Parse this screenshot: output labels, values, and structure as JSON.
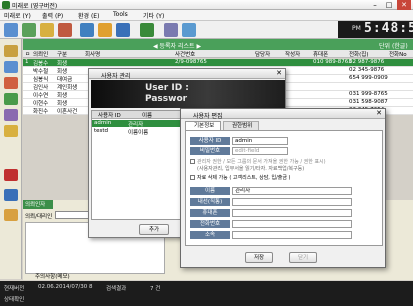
{
  "window": {
    "title": "미래로 (영구버전)"
  },
  "menu": [
    "미래로 (Y)",
    "출력 (P)",
    "환경 (E)",
    "Tools",
    "기타 (Y)"
  ],
  "clock": {
    "ampm": "PM",
    "time": "5:48:5"
  },
  "main": {
    "header_title": "◀ 등록자 리스트 ▶",
    "header_right": "단위 (한글)",
    "columns": [
      "ㅁ",
      "의뢰인",
      "구분",
      "회사명",
      "사건번호",
      "담당자",
      "작성자",
      "휴대폰",
      "전화(집)",
      "전화No"
    ],
    "rows": [
      [
        "1",
        "김봉수",
        "회생",
        "",
        "2/9-098765",
        "",
        "",
        "010 989-8763",
        "02 987-9876",
        ""
      ],
      [
        "",
        "박수철",
        "회생",
        "",
        "",
        "",
        "",
        "",
        "02 345-9876",
        ""
      ],
      [
        "",
        "심봉식",
        "대여금",
        "",
        "",
        "",
        "",
        "",
        "654 999-0909",
        ""
      ],
      [
        "",
        "김인사",
        "계인회생",
        "",
        "",
        "",
        "",
        "",
        "",
        ""
      ],
      [
        "",
        "이수연",
        "회생",
        "",
        "",
        "",
        "",
        "",
        "031 999-8765",
        ""
      ],
      [
        "",
        "이현수",
        "회생",
        "",
        "",
        "",
        "",
        "",
        "031 598-9087",
        ""
      ],
      [
        "",
        "화진수",
        "이혼사건",
        "",
        "",
        "",
        "",
        "",
        "02 345-7654",
        ""
      ]
    ],
    "lower_tab": "의뢰인자",
    "lower_label": "의뢰/대리인",
    "checkbox_label": "개별",
    "bottom_tab": "주의사항(메모)"
  },
  "status": {
    "row1_a": "현재버전",
    "row1_b": "02.06.2014/07/30 8",
    "row1_c": "검색결과",
    "row1_d": "7 건",
    "row2_a": "상태확인"
  },
  "dialog_users": {
    "title": "사용자 관리",
    "banner_line1": "User ID :",
    "banner_line2": "Passwor",
    "col_id": "사용자 ID",
    "col_name": "이름",
    "users": [
      {
        "id": "admin",
        "name": "관리자"
      },
      {
        "id": "testd",
        "name": "이름이름"
      }
    ],
    "add_button": "추가"
  },
  "dialog_edit": {
    "title": "사용자 편집",
    "tabs": [
      "기본정보",
      "권한범위"
    ],
    "id_label": "사용자 ID",
    "id_value": "admin",
    "pw_label": "비밀번호",
    "pw_placeholder": "edit-field",
    "check1": "관리자 권한 / 모든 그룹의 문서 가져올 권한 가능 / 권한 표시)",
    "check1b": "(사용자관리, 입부서을 읽기/타자. 자료백업/복구등)",
    "check2": "자료 삭제 가능 ( 고객리스트, 상담, 입/출금 )",
    "name_label": "이름",
    "name_value": "관리자",
    "dept_label": "내선(직통)",
    "phone_label": "휴대폰",
    "tel_label": "전화번호",
    "memo_label": "소속",
    "save_button": "저장",
    "close_button": "닫기"
  },
  "colors": {
    "accent_green": "#2f8f3f",
    "label_blue": "#607a9a"
  }
}
